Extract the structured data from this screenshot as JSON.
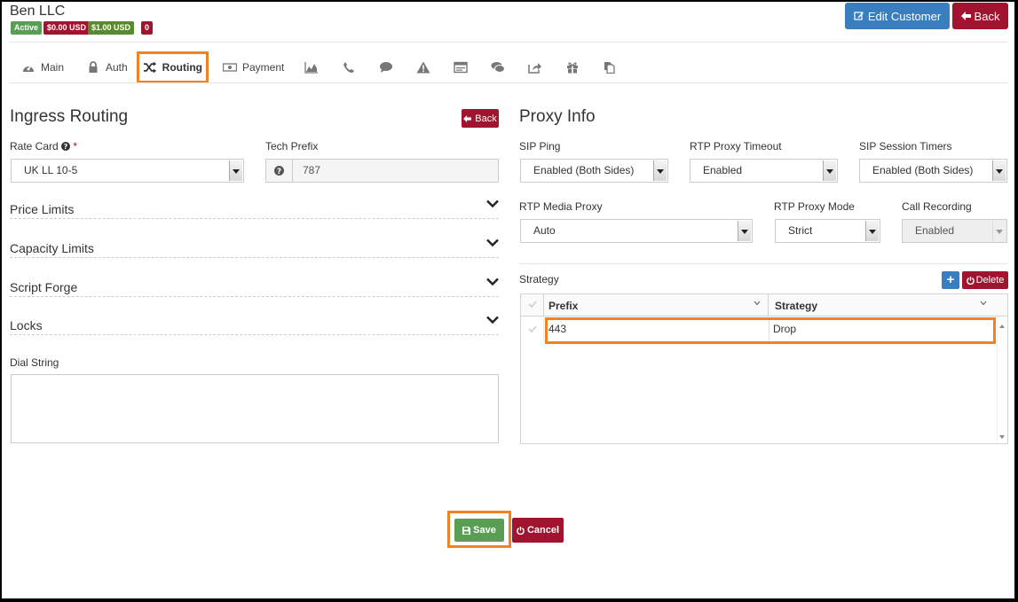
{
  "customer": {
    "name": "Ben LLC",
    "badges": [
      {
        "label": "Active",
        "color": "#5a9e56"
      },
      {
        "label": "$0.00 USD",
        "color": "#a0142f"
      },
      {
        "label": "$1.00 USD",
        "color": "#5a8a2e"
      },
      {
        "label": "0",
        "color": "#a0142f"
      }
    ]
  },
  "header_buttons": {
    "edit_customer": "Edit Customer",
    "back": "Back"
  },
  "tabs": {
    "main": "Main",
    "auth": "Auth",
    "routing": "Routing",
    "payment": "Payment",
    "icon_tabs": [
      "chart-icon",
      "phone-icon",
      "chat-bubble-icon",
      "warning-icon",
      "browser-window-icon",
      "comments-icon",
      "share-icon",
      "gift-icon",
      "copy-document-icon"
    ]
  },
  "ingress": {
    "title": "Ingress Routing",
    "back_label": "Back",
    "rate_card_label": "Rate Card",
    "rate_card_required": "*",
    "rate_card_value": "UK LL 10-5",
    "tech_prefix_label": "Tech Prefix",
    "tech_prefix_value": "787",
    "sections": [
      "Price Limits",
      "Capacity Limits",
      "Script Forge",
      "Locks"
    ],
    "dial_string_label": "Dial String",
    "dial_string_value": ""
  },
  "proxy": {
    "title": "Proxy Info",
    "sip_ping_label": "SIP Ping",
    "sip_ping_value": "Enabled (Both Sides)",
    "rtp_timeout_label": "RTP Proxy Timeout",
    "rtp_timeout_value": "Enabled",
    "sip_timers_label": "SIP Session Timers",
    "sip_timers_value": "Enabled (Both Sides)",
    "rtp_media_label": "RTP Media Proxy",
    "rtp_media_value": "Auto",
    "rtp_mode_label": "RTP Proxy Mode",
    "rtp_mode_value": "Strict",
    "call_recording_label": "Call Recording",
    "call_recording_value": "Enabled"
  },
  "strategy": {
    "label": "Strategy",
    "add_label": "+",
    "delete_label": "Delete",
    "columns": [
      "Prefix",
      "Strategy"
    ],
    "rows": [
      {
        "prefix": "443",
        "strategy": "Drop"
      }
    ]
  },
  "footer": {
    "save": "Save",
    "cancel": "Cancel"
  },
  "colors": {
    "primary": "#3a7ebf",
    "danger": "#a0142f",
    "success": "#5a9e56",
    "highlight": "#f58220"
  }
}
